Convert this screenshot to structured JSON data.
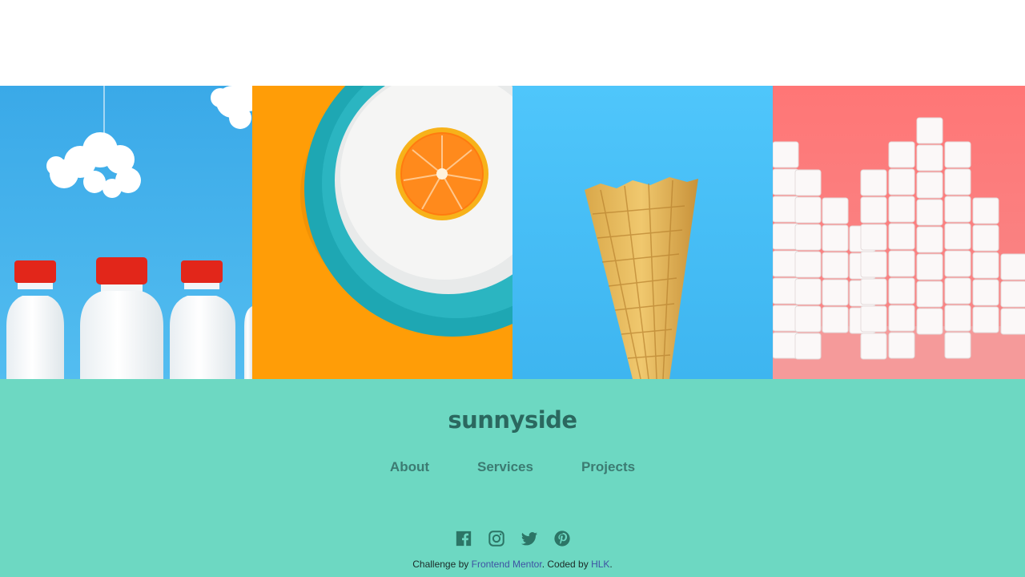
{
  "gallery": {
    "images": [
      {
        "name": "milk-bottles-image",
        "bg": "#3fb0ea"
      },
      {
        "name": "orange-plate-image",
        "bg": "#ff9d07"
      },
      {
        "name": "ice-cream-cone-image",
        "bg": "#45c3f7"
      },
      {
        "name": "sugar-cubes-image",
        "bg": "#f97a7a"
      }
    ]
  },
  "footer": {
    "logo": "sunnyside",
    "nav": [
      "About",
      "Services",
      "Projects"
    ],
    "socials": [
      "facebook-icon",
      "instagram-icon",
      "twitter-icon",
      "pinterest-icon"
    ],
    "attribution": {
      "prefix": "Challenge by ",
      "challenge_link": "Frontend Mentor",
      "middle": ". Coded by ",
      "author_link": "HLK",
      "suffix": "."
    },
    "colors": {
      "background": "#6dd8c2",
      "logo": "#2b685f",
      "nav": "#3c7b72",
      "link": "#3e52a3"
    }
  }
}
